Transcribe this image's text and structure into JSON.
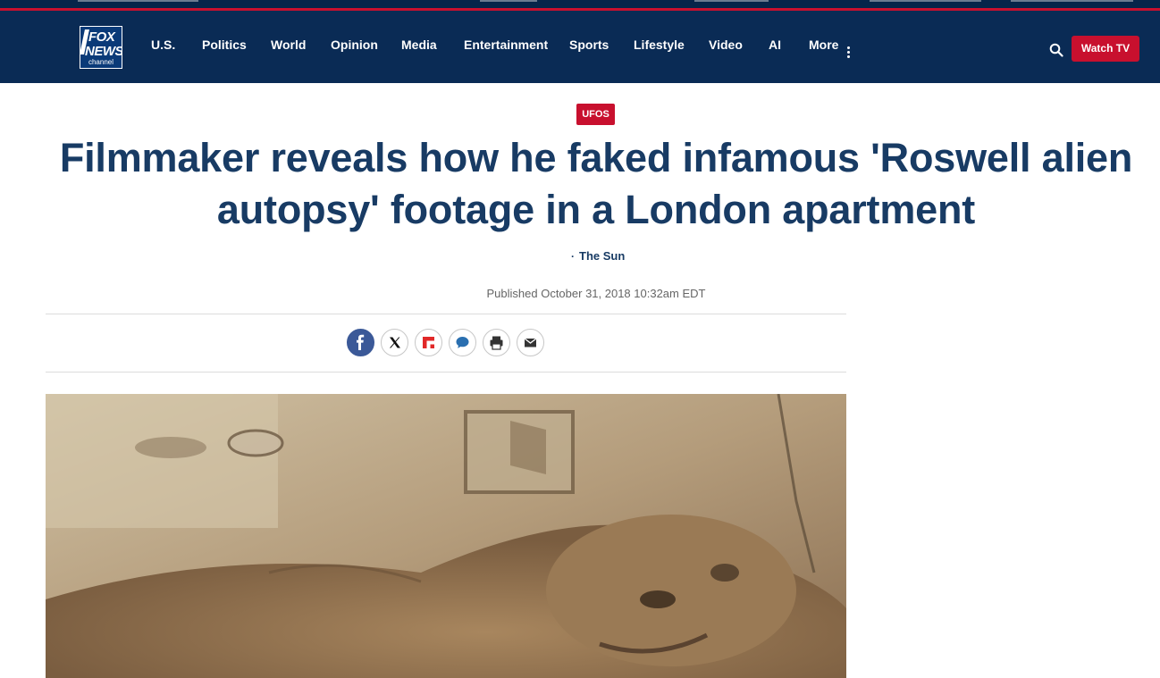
{
  "brand": {
    "logo_line1": "FOX",
    "logo_line2": "NEWS",
    "logo_line3": "channel",
    "color_header": "#0a2b55",
    "color_accent": "#c8102e"
  },
  "nav": {
    "items": [
      "U.S.",
      "Politics",
      "World",
      "Opinion",
      "Media",
      "Entertainment",
      "Sports",
      "Lifestyle",
      "Video",
      "AI",
      "More"
    ],
    "watch_tv": "Watch TV"
  },
  "article": {
    "tag": "UFOS",
    "headline": "Filmmaker reveals how he faked infamous 'Roswell alien autopsy' footage in a London apartment",
    "byline": "The Sun",
    "published": "Published October 31, 2018 10:32am EDT"
  },
  "share": {
    "icons": [
      "facebook-icon",
      "x-twitter-icon",
      "flipboard-icon",
      "comments-icon",
      "print-icon",
      "email-icon"
    ],
    "colors": {
      "facebook": "#3b5998",
      "x": "#ffffff",
      "flipboard": "#e12828",
      "comments": "#2a6fb0",
      "print": "#ffffff",
      "email": "#ffffff"
    }
  }
}
